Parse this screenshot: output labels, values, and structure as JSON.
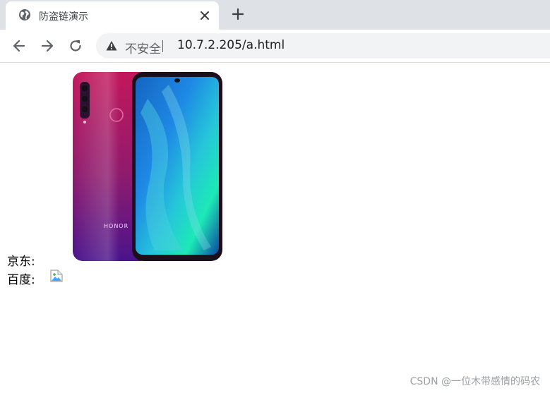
{
  "tab": {
    "title": "防盗链演示",
    "favicon": "globe-icon",
    "close_icon": "close-icon",
    "new_tab_icon": "plus-icon"
  },
  "toolbar": {
    "back_icon": "arrow-left-icon",
    "forward_icon": "arrow-right-icon",
    "reload_icon": "reload-icon"
  },
  "address_bar": {
    "security_icon": "warning-icon",
    "security_label": "不安全",
    "url": "10.7.2.205/a.html"
  },
  "page": {
    "jd_label": "京东:",
    "baidu_label": "百度:",
    "jd_image": "honor-phone-image",
    "baidu_image": "broken-image-icon"
  },
  "watermark": "CSDN @一位木带感情的码农",
  "colors": {
    "tabstrip": "#dee1e6",
    "omnibox": "#f1f3f4",
    "phone_back_top": "#c2185b",
    "phone_back_bottom": "#4a148c",
    "screen_blue": "#1e88e5",
    "screen_cyan": "#26c6da"
  }
}
